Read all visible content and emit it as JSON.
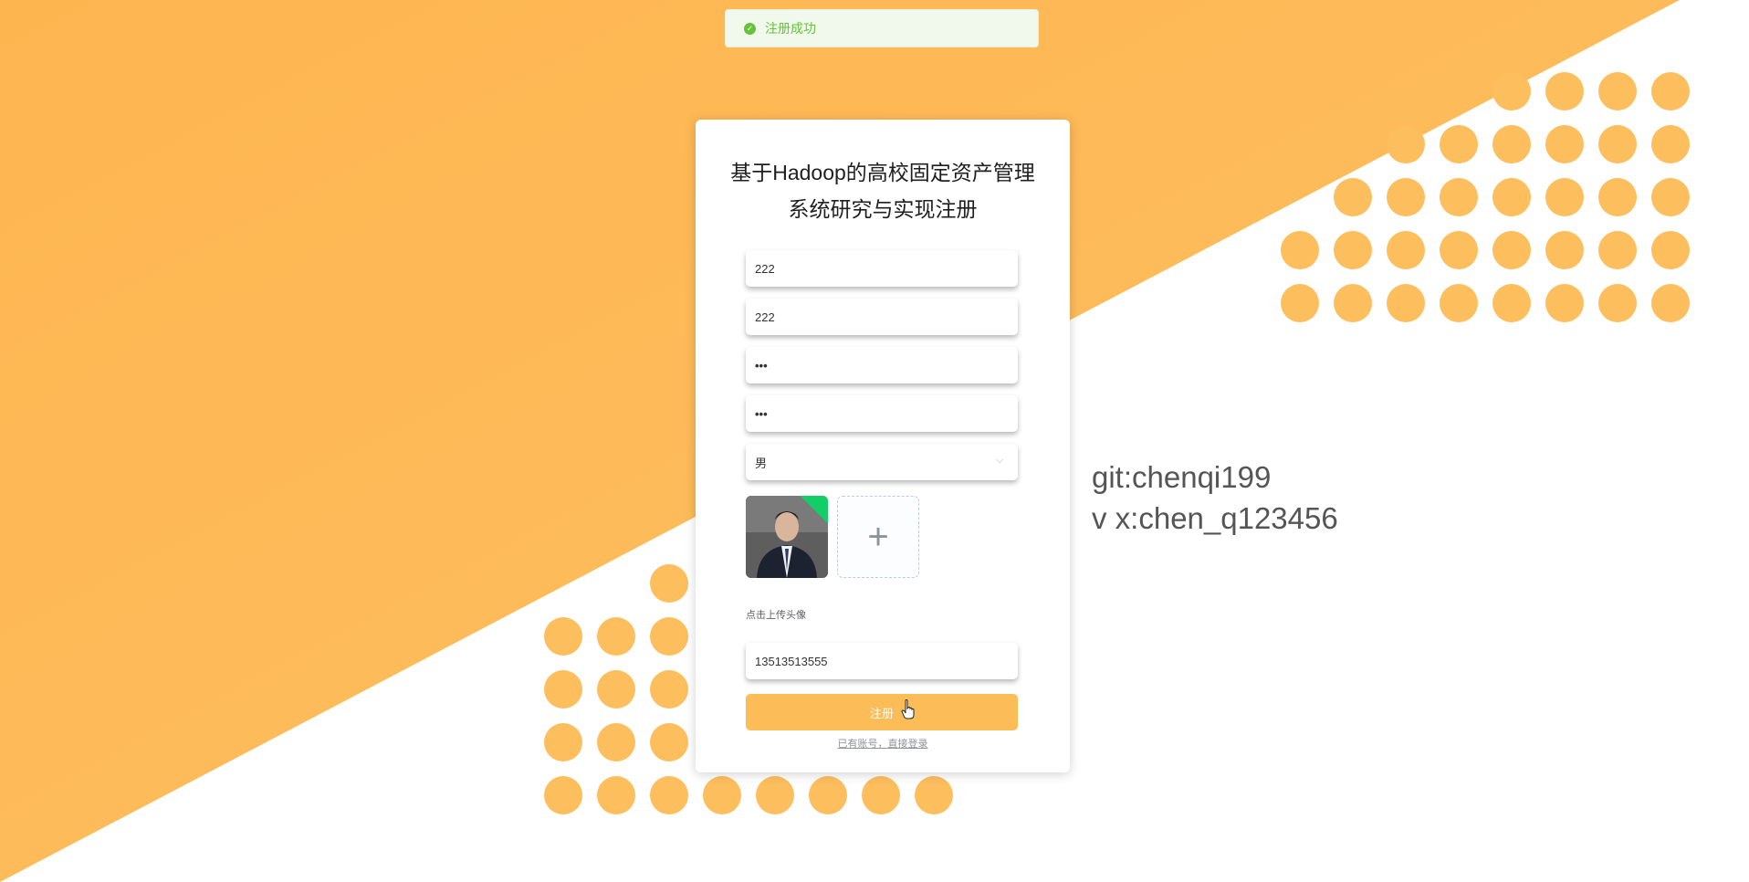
{
  "toast": {
    "message": "注册成功",
    "icon": "success-check-icon",
    "color": "#67c23a"
  },
  "form": {
    "title_line1": "基于Hadoop的高校固定资产管理",
    "title_line2": "系统研究与实现注册",
    "username_value": "222",
    "name_value": "222",
    "password_value": "•••",
    "confirm_password_value": "•••",
    "gender_selected": "男",
    "avatar_upload_hint": "点击上传头像",
    "phone_value": "13513513555",
    "submit_label": "注册",
    "login_link": "已有账号，直接登录"
  },
  "side_info": {
    "line1": "git:chenqi199",
    "line2": "v x:chen_q123456"
  },
  "colors": {
    "accent": "#fcbc57",
    "background_orange": "#fdb95a",
    "success": "#67c23a"
  }
}
